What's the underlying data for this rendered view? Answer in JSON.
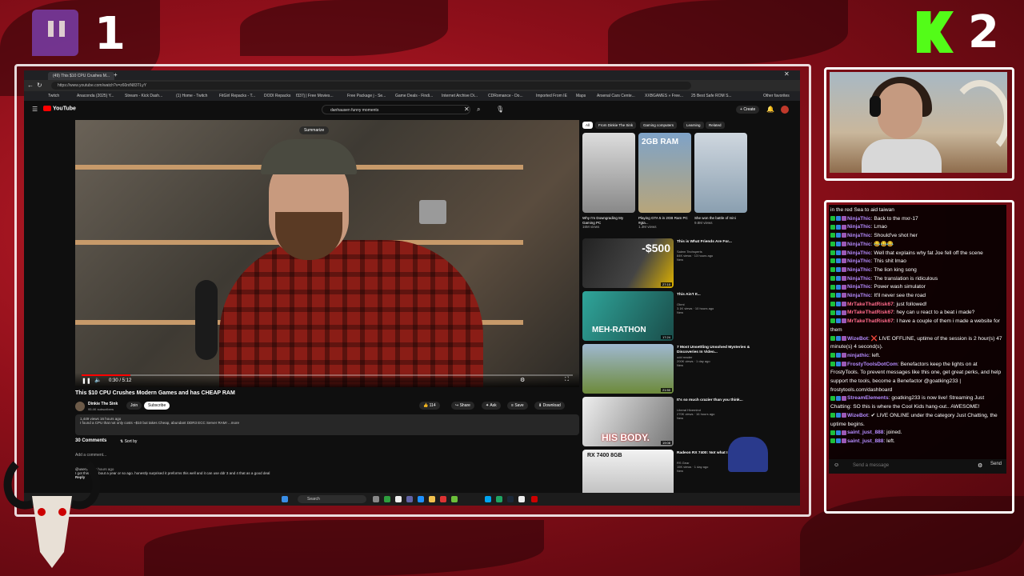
{
  "overlay": {
    "left_number": "1",
    "right_number": "2"
  },
  "browser": {
    "tabs": [
      "(49) This $10 CPU Crushes M..."
    ],
    "url": "https://www.youtube.com/watch?v=z60ntN83TLyY",
    "bookmarks": [
      "Twitch",
      "Anaconda (2025) Y...",
      "Stream - Kick Dash...",
      "(1) Home - Twitch",
      "FitGirl Repacks - T...",
      "DODI Repacks",
      "f337j | Free Movies...",
      "Free Package j - Se...",
      "Game Deals - Findi...",
      "Internet Archive Di...",
      "CDRomance - Do...",
      "Imported From IE",
      "Maps",
      "Arsenal Cars Cente...",
      "XXBGAMES » Free...",
      "25 Best Safe ROM S...",
      "Other favorites"
    ]
  },
  "youtube": {
    "logo": "YouTube",
    "search_value": "danhausen funny moments",
    "create_label": "Create",
    "summarize_label": "Summarize",
    "time": "0:30 / 5:12",
    "video_title": "This $10 CPU Crushes Modern Games and has CHEAP RAM",
    "channel": "Dinkie The Sink",
    "subscribers": "95.4K subscribers",
    "join": "Join",
    "subscribe": "Subscribe",
    "likes": "114",
    "share": "Share",
    "ask": "Ask",
    "save": "Save",
    "download": "Download",
    "desc_line1": "1,449 views  16 hours ago",
    "desc_line2": "I found a CPU that not only costs ~$10 but takes Cheap, abundant DDR3 ECC Server RAM! ...more",
    "comments_count": "30 Comments",
    "sort_by": "Sort by",
    "add_comment": "Add a comment...",
    "comment_user": "@user1739",
    "comment_time": "6 hours ago",
    "comment_text": "I got this cpu about a year or so ago. honestly surprised it preforms this well and it can use ddr 3 and 4 that as a good deal",
    "reply": "Reply",
    "chips": [
      "All",
      "From Dinkie The Sink",
      "Gaming computers",
      "Learning",
      "Related"
    ],
    "shorts": [
      {
        "title": "Why I'm Downgrading My Gaming PC",
        "views": "16M views"
      },
      {
        "title": "Playing GTA 5 in 2GB Ram PC #gta...",
        "views": "1.3M views"
      },
      {
        "title": "She won the battle of mini",
        "views": "9.8M views"
      }
    ],
    "shorts_overlay": "2GB RAM",
    "recs": [
      {
        "title": "This is What Friends Are For...",
        "channel": "Salem Techsperts",
        "meta": "84K views · 13 hours ago",
        "badge": "New",
        "overlay": "-$500",
        "dur": "27:10"
      },
      {
        "title": "This Ain't It...",
        "channel": "Obmi",
        "meta": "3.1K views · 10 hours ago",
        "badge": "New",
        "overlay": "MEH-RATHON",
        "dur": "17:24"
      },
      {
        "title": "7 Most Unsettling Unsolved Mysteries & Discoveries In Video...",
        "channel": "odd reader",
        "meta": "200K views · 1 day ago",
        "badge": "New",
        "overlay": "",
        "dur": "21:50"
      },
      {
        "title": "It's so much crazier than you think...",
        "channel": "Liberal Hivemind",
        "meta": "270K views · 16 hours ago",
        "badge": "New",
        "overlay": "HIS BODY.",
        "dur": "19:08"
      },
      {
        "title": "Radeon RX 7400: Not what I expected!",
        "channel": "RS Gear",
        "meta": "15K views · 1 day ago",
        "badge": "New",
        "overlay": "RX 7400 8GB",
        "dur": ""
      }
    ]
  },
  "taskbar": {
    "search": "Search"
  },
  "chat": {
    "lines": [
      {
        "user": "",
        "text": "in the red Sea to aid taiwan",
        "color": "#ffffff"
      },
      {
        "user": "NinjaThic",
        "text": "Back to the mxr-17",
        "color": "#b58cff"
      },
      {
        "user": "NinjaThic",
        "text": "Lmao",
        "color": "#b58cff"
      },
      {
        "user": "NinjaThic",
        "text": "Should've shot her",
        "color": "#b58cff"
      },
      {
        "user": "NinjaThic",
        "text": "😂😂😂",
        "color": "#b58cff"
      },
      {
        "user": "NinjaThic",
        "text": "Well that explains why fat Joe fell off the scene",
        "color": "#b58cff"
      },
      {
        "user": "NinjaThic",
        "text": "This shit lmao",
        "color": "#b58cff"
      },
      {
        "user": "NinjaThic",
        "text": "The lion king song",
        "color": "#b58cff"
      },
      {
        "user": "NinjaThic",
        "text": "The translation is ridiculous",
        "color": "#b58cff"
      },
      {
        "user": "NinjaThic",
        "text": "Power wash simulator",
        "color": "#b58cff"
      },
      {
        "user": "NinjaThic",
        "text": "It'll never see the road",
        "color": "#b58cff"
      },
      {
        "user": "MrTakeThatRisk67",
        "text": "just followed!",
        "color": "#ff6b8b"
      },
      {
        "user": "MrTakeThatRisk67",
        "text": "hey can u react to a beat i made?",
        "color": "#ff6b8b"
      },
      {
        "user": "MrTakeThatRisk67",
        "text": "I have a couple of them i made a website for them",
        "color": "#ff6b8b"
      },
      {
        "user": "WizeBot",
        "text": "❌ LIVE OFFLINE, uptime of the session is 2 hour(s) 47 minute(s) 4 second(s).",
        "color": "#b58cff"
      },
      {
        "user": "ninjathic",
        "text": "left.",
        "color": "#b58cff"
      },
      {
        "user": "FrostyToolsDotCom",
        "text": "Benefactors keep the lights on at FrostyTools. To prevent messages like this one, get great perks, and help support the tools, become a Benefactor @goatking233 | frostytools.com/dashboard",
        "color": "#b58cff"
      },
      {
        "user": "StreamElements",
        "text": "goatking233 is now live! Streaming Just Chatting: SO this is where the Cool Kids hang-out.. AWESOME!",
        "color": "#b58cff"
      },
      {
        "user": "WizeBot",
        "text": "✔ LIVE ONLINE under the category Just Chatting, the uptime begins.",
        "color": "#b58cff"
      },
      {
        "user": "saint_just_888",
        "text": "joined.",
        "color": "#b58cff"
      },
      {
        "user": "saint_just_888",
        "text": "left.",
        "color": "#b58cff"
      }
    ],
    "input_placeholder": "Send a message",
    "send_label": "Send"
  }
}
